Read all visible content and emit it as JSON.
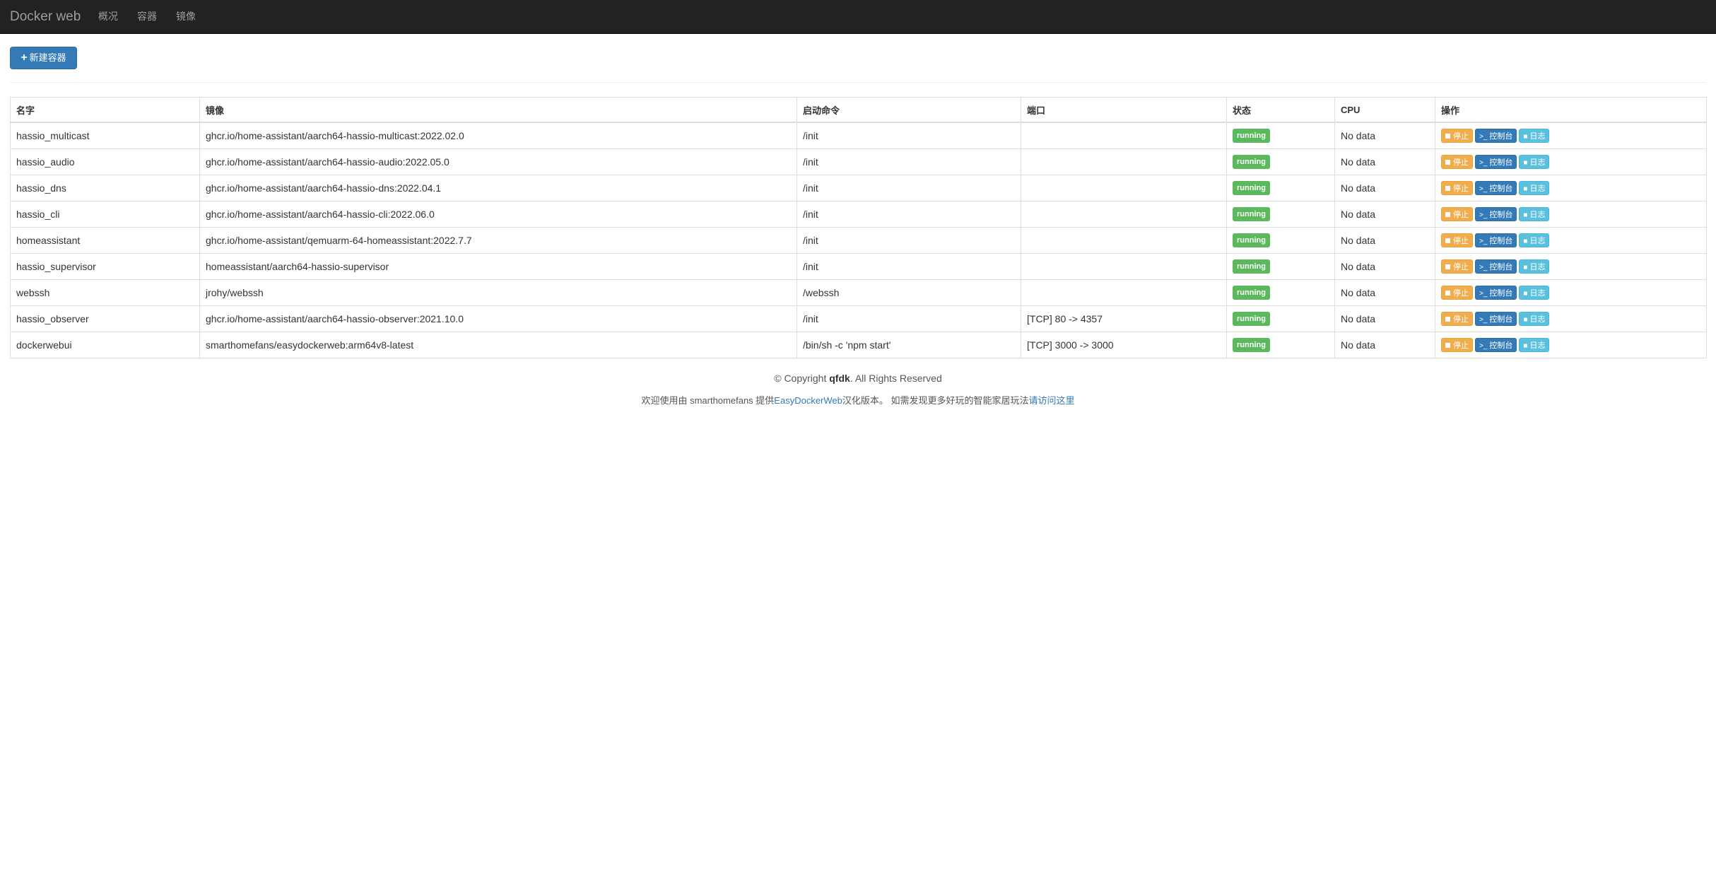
{
  "navbar": {
    "brand": "Docker web",
    "links": [
      "概况",
      "容器",
      "镜像"
    ]
  },
  "toolbar": {
    "new_container_label": "新建容器"
  },
  "table": {
    "headers": [
      "名字",
      "镜像",
      "启动命令",
      "端口",
      "状态",
      "CPU",
      "操作"
    ],
    "rows": [
      {
        "name": "hassio_multicast",
        "image": "ghcr.io/home-assistant/aarch64-hassio-multicast:2022.02.0",
        "command": "/init",
        "ports": "",
        "status": "running",
        "cpu": "No data"
      },
      {
        "name": "hassio_audio",
        "image": "ghcr.io/home-assistant/aarch64-hassio-audio:2022.05.0",
        "command": "/init",
        "ports": "",
        "status": "running",
        "cpu": "No data"
      },
      {
        "name": "hassio_dns",
        "image": "ghcr.io/home-assistant/aarch64-hassio-dns:2022.04.1",
        "command": "/init",
        "ports": "",
        "status": "running",
        "cpu": "No data"
      },
      {
        "name": "hassio_cli",
        "image": "ghcr.io/home-assistant/aarch64-hassio-cli:2022.06.0",
        "command": "/init",
        "ports": "",
        "status": "running",
        "cpu": "No data"
      },
      {
        "name": "homeassistant",
        "image": "ghcr.io/home-assistant/qemuarm-64-homeassistant:2022.7.7",
        "command": "/init",
        "ports": "",
        "status": "running",
        "cpu": "No data"
      },
      {
        "name": "hassio_supervisor",
        "image": "homeassistant/aarch64-hassio-supervisor",
        "command": "/init",
        "ports": "",
        "status": "running",
        "cpu": "No data"
      },
      {
        "name": "webssh",
        "image": "jrohy/webssh",
        "command": "/webssh",
        "ports": "",
        "status": "running",
        "cpu": "No data"
      },
      {
        "name": "hassio_observer",
        "image": "ghcr.io/home-assistant/aarch64-hassio-observer:2021.10.0",
        "command": "/init",
        "ports": "[TCP] 80 -> 4357",
        "status": "running",
        "cpu": "No data"
      },
      {
        "name": "dockerwebui",
        "image": "smarthomefans/easydockerweb:arm64v8-latest",
        "command": "/bin/sh -c 'npm start'",
        "ports": "[TCP] 3000 -> 3000",
        "status": "running",
        "cpu": "No data"
      }
    ],
    "actions": {
      "stop": "停止",
      "console": "控制台",
      "log": "日志"
    }
  },
  "footer": {
    "copyright_prefix": "© Copyright ",
    "copyright_owner": "qfdk",
    "copyright_suffix": ". All Rights Reserved",
    "welcome_prefix": "欢迎使用由 smarthomefans 提供",
    "welcome_link": "EasyDockerWeb",
    "welcome_middle": "汉化版本。 如需发现更多好玩的智能家居玩法",
    "welcome_visit": "请访问这里"
  },
  "colors": {
    "navbar_bg": "#222222",
    "primary": "#337ab7",
    "warning": "#f0ad4e",
    "info": "#5bc0de",
    "success": "#5cb85c"
  },
  "icons": {
    "new_button": "plus-icon",
    "stop": "stop-square-icon",
    "console": "terminal-icon",
    "log": "comment-icon"
  }
}
